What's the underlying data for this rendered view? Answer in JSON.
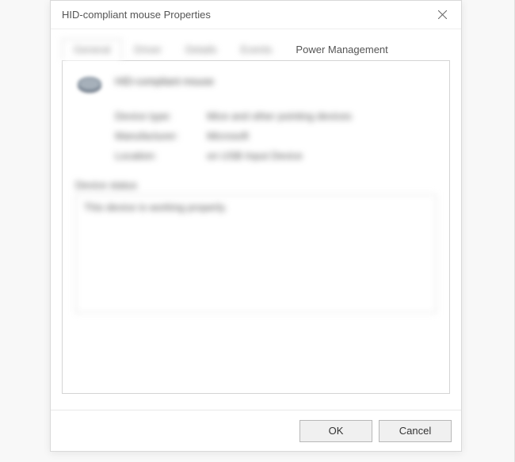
{
  "dialog": {
    "title": "HID-compliant mouse Properties",
    "tabs": [
      {
        "label": "General"
      },
      {
        "label": "Driver"
      },
      {
        "label": "Details"
      },
      {
        "label": "Events"
      },
      {
        "label": "Power Management"
      }
    ],
    "device": {
      "name": "HID-compliant mouse",
      "rows": [
        {
          "label": "Device type:",
          "value": "Mice and other pointing devices"
        },
        {
          "label": "Manufacturer:",
          "value": "Microsoft"
        },
        {
          "label": "Location:",
          "value": "on USB Input Device"
        }
      ]
    },
    "status": {
      "label": "Device status",
      "text": "This device is working properly."
    },
    "buttons": {
      "ok": "OK",
      "cancel": "Cancel"
    }
  }
}
